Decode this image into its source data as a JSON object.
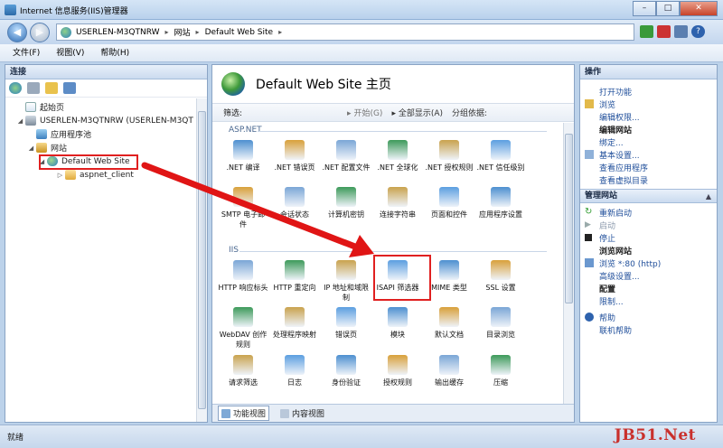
{
  "window": {
    "title": "Internet 信息服务(IIS)管理器",
    "min": "–",
    "max": "□",
    "close": "✕"
  },
  "address": {
    "segments": [
      "USERLEN-M3QTNRW",
      "网站",
      "Default Web Site"
    ],
    "sep": "▸"
  },
  "menu": [
    "文件(F)",
    "视图(V)",
    "帮助(H)"
  ],
  "left": {
    "header": "连接",
    "tree": [
      {
        "label": "起始页",
        "icon": "page"
      },
      {
        "label": "USERLEN-M3QTNRW (USERLEN-M3QT",
        "icon": "server"
      },
      {
        "label": "应用程序池",
        "icon": "pool"
      },
      {
        "label": "网站",
        "icon": "sites"
      },
      {
        "label": "Default Web Site",
        "icon": "globe"
      },
      {
        "label": "aspnet_client",
        "icon": "folder"
      }
    ]
  },
  "center": {
    "title": "Default Web Site 主页",
    "filter_label": "筛选:",
    "start": "开始(G)",
    "show_all": "全部显示(A)",
    "group_by": "分组依据:",
    "groups": [
      "ASP.NET",
      "IIS"
    ],
    "features": [
      ".NET 编译",
      ".NET 错误页",
      ".NET 配置文件",
      ".NET 全球化",
      ".NET 授权规则",
      ".NET 信任级别",
      "SMTP 电子邮件",
      "会话状态",
      "计算机密钥",
      "连接字符串",
      "页面和控件",
      "应用程序设置",
      "HTTP 响应标头",
      "HTTP 重定向",
      "IP 地址和域限制",
      "ISAPI 筛选器",
      "MIME 类型",
      "SSL 设置",
      "WebDAV 创作规则",
      "处理程序映射",
      "错误页",
      "模块",
      "默认文档",
      "目录浏览",
      "请求筛选",
      "日志",
      "身份验证",
      "授权规则",
      "输出缓存",
      "压缩"
    ],
    "tabs": [
      "功能视图",
      "内容视图"
    ]
  },
  "right": {
    "header": "操作",
    "actions1": [
      "打开功能",
      "浏览",
      "编辑权限..."
    ],
    "edit_site": "编辑网站",
    "actions2": [
      "绑定...",
      "基本设置...",
      "查看应用程序",
      "查看虚拟目录"
    ],
    "manage_site": "管理网站",
    "manage_actions": [
      "重新启动",
      "启动",
      "停止"
    ],
    "browse_site": "浏览网站",
    "browse_link": "浏览 *:80 (http)",
    "advanced": "高级设置...",
    "config": "配置",
    "limits": "限制...",
    "help": "帮助",
    "online_help": "联机帮助"
  },
  "status": {
    "text": "就绪",
    "watermark": "JB51.Net"
  }
}
